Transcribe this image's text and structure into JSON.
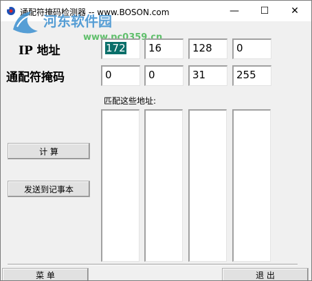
{
  "window": {
    "title": "通配符掩码检测器  --  www.BOSON.com",
    "minimize_glyph": "—",
    "maximize_glyph": "☐",
    "close_glyph": "✕"
  },
  "watermark": {
    "main": "河东软件园",
    "sub": "www.pc0359.cn"
  },
  "labels": {
    "ip": "IP 地址",
    "mask": "通配符掩码",
    "matching": "匹配这些地址:"
  },
  "ip_fields": [
    "172",
    "16",
    "128",
    "0"
  ],
  "mask_fields": [
    "0",
    "0",
    "31",
    "255"
  ],
  "buttons": {
    "calculate": "计   算",
    "send_notepad": "发送到记事本",
    "menu": "菜   单",
    "exit": "退   出"
  },
  "icons": {
    "app": "app-icon",
    "logo": "watermark-logo-icon"
  },
  "colors": {
    "selection": "#0a6f6a",
    "watermark_blue": "#3b8fd0",
    "watermark_green": "#3bb34a"
  }
}
